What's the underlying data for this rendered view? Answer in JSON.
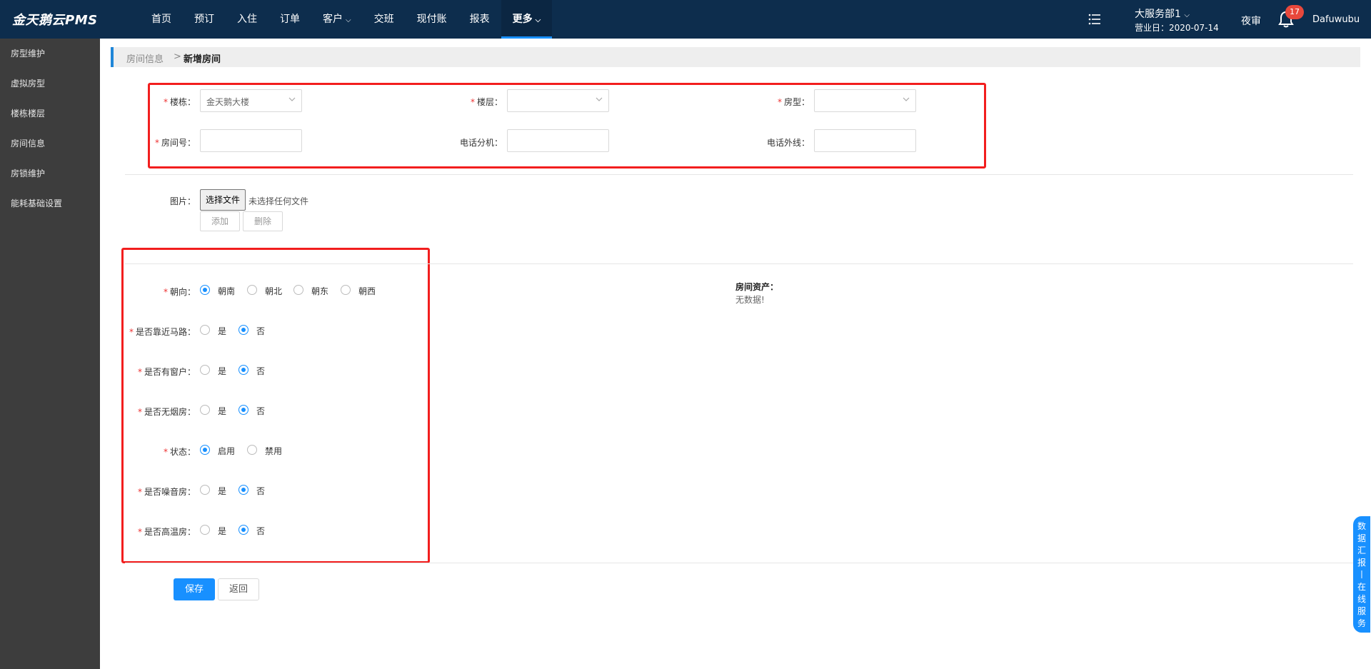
{
  "header": {
    "brand": "金天鹅云PMS",
    "nav": [
      {
        "label": "首页",
        "chevron": false
      },
      {
        "label": "预订",
        "chevron": false
      },
      {
        "label": "入住",
        "chevron": false
      },
      {
        "label": "订单",
        "chevron": false
      },
      {
        "label": "客户",
        "chevron": true
      },
      {
        "label": "交班",
        "chevron": false
      },
      {
        "label": "现付账",
        "chevron": false
      },
      {
        "label": "报表",
        "chevron": false
      },
      {
        "label": "更多",
        "chevron": true,
        "active": true
      }
    ],
    "department": "大服务部1",
    "business_date_label": "营业日：2020-07-14",
    "night_audit": "夜审",
    "notification_count": "17",
    "username": "Dafuwubu",
    "colors": {
      "bg": "#0d2d4d",
      "accent": "#1890ff",
      "badge": "#e8483c"
    }
  },
  "sidebar": {
    "items": [
      "房型维护",
      "虚拟房型",
      "楼栋楼层",
      "房间信息",
      "房锁维护",
      "能耗基础设置"
    ]
  },
  "breadcrumb": {
    "parent": "房间信息",
    "separator": ">",
    "current": "新增房间"
  },
  "form": {
    "required_mark": "*",
    "building": {
      "label": "楼栋：",
      "value": "金天鹅大楼"
    },
    "floor": {
      "label": "楼层：",
      "value": ""
    },
    "room_type": {
      "label": "房型：",
      "value": ""
    },
    "room_no": {
      "label": "房间号：",
      "value": ""
    },
    "phone_ext": {
      "label": "电话分机：",
      "value": ""
    },
    "phone_line": {
      "label": "电话外线：",
      "value": ""
    },
    "image": {
      "label": "图片：",
      "file_button": "选择文件",
      "file_status": "未选择任何文件",
      "add": "添加",
      "delete": "删除"
    },
    "orientation": {
      "label": "朝向：",
      "options": [
        "朝南",
        "朝北",
        "朝东",
        "朝西"
      ],
      "selected": "朝南"
    },
    "near_road": {
      "label": "是否靠近马路：",
      "options": [
        "是",
        "否"
      ],
      "selected": "否"
    },
    "has_window": {
      "label": "是否有窗户：",
      "options": [
        "是",
        "否"
      ],
      "selected": "否"
    },
    "non_smoking": {
      "label": "是否无烟房：",
      "options": [
        "是",
        "否"
      ],
      "selected": "否"
    },
    "status": {
      "label": "状态：",
      "options": [
        "启用",
        "禁用"
      ],
      "selected": "启用"
    },
    "noisy": {
      "label": "是否噪音房：",
      "options": [
        "是",
        "否"
      ],
      "selected": "否"
    },
    "high_temp": {
      "label": "是否高温房：",
      "options": [
        "是",
        "否"
      ],
      "selected": "否"
    }
  },
  "assets": {
    "title": "房间资产：",
    "empty": "无数据!"
  },
  "actions": {
    "save": "保存",
    "back": "返回"
  },
  "float_tab": "数据汇报丨在线服务"
}
